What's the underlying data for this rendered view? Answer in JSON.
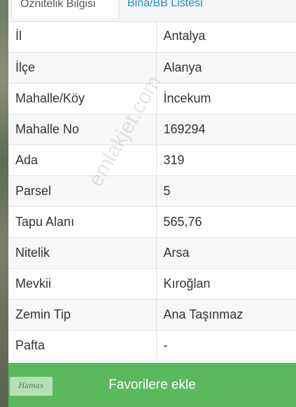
{
  "tabs": [
    {
      "label": "Öznitelik Bilgisi",
      "active": true
    },
    {
      "label": "Bina/BB Listesi",
      "active": false
    }
  ],
  "attributes": [
    {
      "key": "İl",
      "value": "Antalya"
    },
    {
      "key": "İlçe",
      "value": "Alanya"
    },
    {
      "key": "Mahalle/Köy",
      "value": "İncekum"
    },
    {
      "key": "Mahalle No",
      "value": "169294"
    },
    {
      "key": "Ada",
      "value": "319"
    },
    {
      "key": "Parsel",
      "value": "5"
    },
    {
      "key": "Tapu Alanı",
      "value": "565,76"
    },
    {
      "key": "Nitelik",
      "value": "Arsa"
    },
    {
      "key": "Mevkii",
      "value": "Kıroğlan"
    },
    {
      "key": "Zemin Tip",
      "value": "Ana Taşınmaz"
    },
    {
      "key": "Pafta",
      "value": "-"
    }
  ],
  "watermark": "emlakjet.com",
  "footer": {
    "button_label": "Favorilere ekle",
    "logo_text": "Hamax"
  },
  "colors": {
    "accent_green": "#5cb85c",
    "tab_link": "#1e8fc7"
  }
}
